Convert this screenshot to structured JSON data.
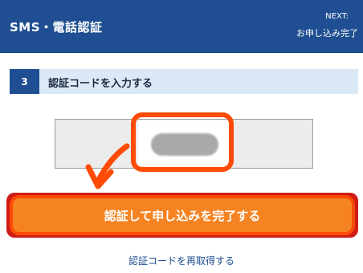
{
  "header": {
    "title": "SMS・電話認証",
    "next_label": "NEXT:",
    "next_value": "お申し込み完了"
  },
  "step": {
    "number": "3",
    "label": "認証コードを入力する"
  },
  "code_input": {
    "value": "",
    "placeholder": ""
  },
  "submit": {
    "label": "認証して申し込みを完了する"
  },
  "resend": {
    "label": "認証コードを再取得する"
  },
  "colors": {
    "header_bg": "#1f4f92",
    "step_bar_bg": "#dbe8f6",
    "submit_bg": "#f58322",
    "annotation": "#ff4b06"
  }
}
